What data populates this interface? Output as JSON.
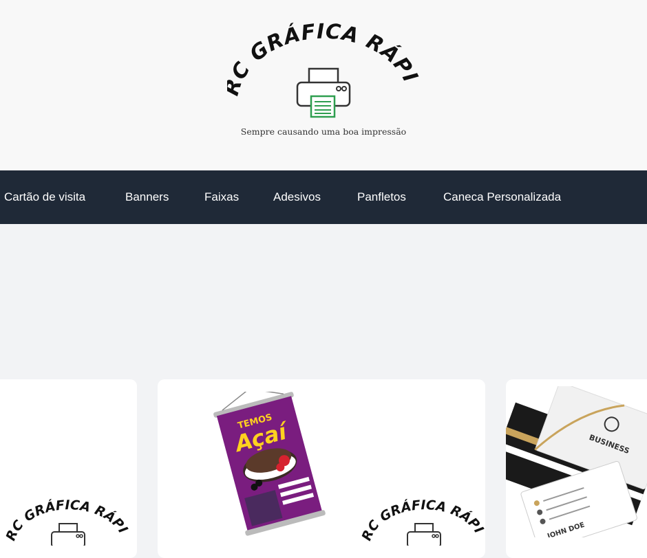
{
  "header": {
    "logo_text": "MRC GRÁFICA RÁPIDA",
    "tagline": "Sempre causando uma boa impressão"
  },
  "nav": {
    "items": [
      {
        "label": "Cartão de visita"
      },
      {
        "label": "Banners"
      },
      {
        "label": "Faixas"
      },
      {
        "label": "Adesivos"
      },
      {
        "label": "Panfletos"
      },
      {
        "label": "Caneca Personalizada"
      }
    ]
  },
  "cards": {
    "logo_text": "MRC GRÁFICA RÁPIDA",
    "banner": {
      "line1": "TEMOS",
      "line2": "Açaí"
    },
    "business_card": {
      "brand": "BUSINESS",
      "name": "JOHN DOE"
    }
  },
  "colors": {
    "nav_bg": "#1f2937",
    "page_bg": "#f2f3f5",
    "header_bg": "#f8f8f8",
    "banner_purple": "#7a1d7f",
    "banner_yellow": "#ffd21f",
    "printer_green": "#2e9e4f",
    "card_gold": "#c9a45c"
  },
  "icons": [
    "printer-icon"
  ]
}
